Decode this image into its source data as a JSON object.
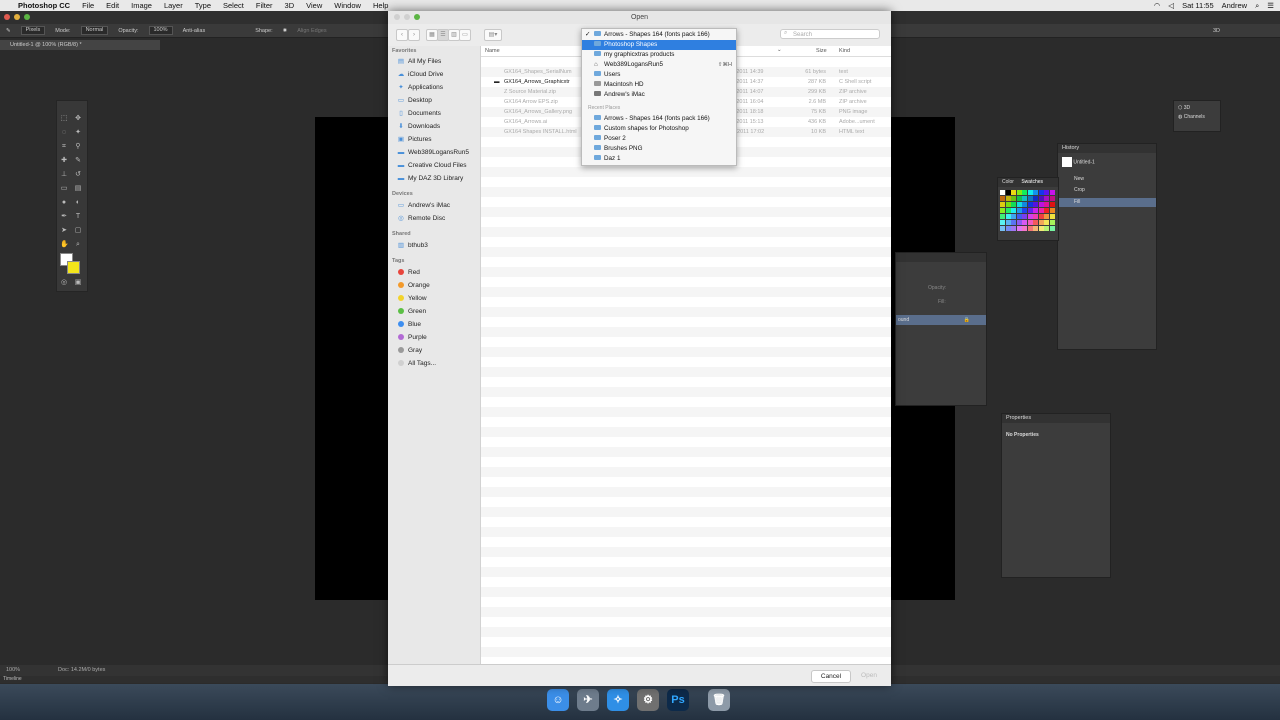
{
  "menubar": {
    "app_name": "Photoshop CC",
    "items": [
      "File",
      "Edit",
      "Image",
      "Layer",
      "Type",
      "Select",
      "Filter",
      "3D",
      "View",
      "Window",
      "Help"
    ],
    "clock": "Sat 11:55",
    "user": "Andrew"
  },
  "options_bar": {
    "tool_mode": "Pixels",
    "mode_label": "Mode:",
    "mode_value": "Normal",
    "opacity_label": "Opacity:",
    "opacity_value": "100%",
    "antialias_label": "Anti-alias",
    "shape_label": "Shape:",
    "align_edges_label": "Align Edges",
    "workspace_label": "3D"
  },
  "document": {
    "tab_title": "Untitled-1 @ 100% (RGB/8) *",
    "zoom": "100%",
    "doc_info": "Doc: 14.2M/0 bytes",
    "timeline_label": "Timeline"
  },
  "panels": {
    "mini": {
      "item1": "3D",
      "item2": "Channels"
    },
    "history": {
      "title": "History",
      "snapshot": "Untitled-1",
      "states": [
        "New",
        "Crop",
        "Fill"
      ]
    },
    "color": {
      "tab1": "Color",
      "tab2": "Swatches"
    },
    "layers": {
      "opacity_label": "Opacity:",
      "fill_label": "Fill:",
      "layer_name": "ound"
    },
    "properties": {
      "title": "Properties",
      "content": "No Properties"
    }
  },
  "dialog": {
    "title": "Open",
    "search_placeholder": "Search",
    "sidebar": {
      "favorites_header": "Favorites",
      "favorites": [
        {
          "label": "All My Files",
          "icon": "all-files-icon"
        },
        {
          "label": "iCloud Drive",
          "icon": "cloud-icon"
        },
        {
          "label": "Applications",
          "icon": "applications-icon"
        },
        {
          "label": "Desktop",
          "icon": "desktop-icon"
        },
        {
          "label": "Documents",
          "icon": "documents-icon"
        },
        {
          "label": "Downloads",
          "icon": "downloads-icon"
        },
        {
          "label": "Pictures",
          "icon": "pictures-icon"
        },
        {
          "label": "Web389LogansRun5",
          "icon": "folder-icon"
        },
        {
          "label": "Creative Cloud Files",
          "icon": "folder-icon"
        },
        {
          "label": "My DAZ 3D Library",
          "icon": "folder-icon"
        }
      ],
      "devices_header": "Devices",
      "devices": [
        {
          "label": "Andrew's iMac",
          "icon": "imac-icon"
        },
        {
          "label": "Remote Disc",
          "icon": "disc-icon"
        }
      ],
      "shared_header": "Shared",
      "shared": [
        {
          "label": "bthub3",
          "icon": "server-icon"
        }
      ],
      "tags_header": "Tags",
      "tags": [
        {
          "label": "Red",
          "color": "#e8453c"
        },
        {
          "label": "Orange",
          "color": "#f39a2b"
        },
        {
          "label": "Yellow",
          "color": "#f2d32c"
        },
        {
          "label": "Green",
          "color": "#5bbf45"
        },
        {
          "label": "Blue",
          "color": "#3d8ef0"
        },
        {
          "label": "Purple",
          "color": "#b26ad4"
        },
        {
          "label": "Gray",
          "color": "#9a9a9a"
        },
        {
          "label": "All Tags...",
          "color": "#d0d0d0"
        }
      ]
    },
    "columns": {
      "name": "Name",
      "date": "d",
      "size": "Size",
      "kind": "Kind"
    },
    "files": [
      {
        "name": "GX164_Shapes_SerialNum",
        "date": "r 2011 14:39",
        "size": "61 bytes",
        "kind": "text",
        "enabled": false
      },
      {
        "name": "GX164_Arrows_Graphicxtr",
        "date": "r 2011 14:37",
        "size": "287 KB",
        "kind": "C Shell script",
        "enabled": true
      },
      {
        "name": "Z Source Material.zip",
        "date": "r 2011 14:07",
        "size": "299 KB",
        "kind": "ZIP archive",
        "enabled": false
      },
      {
        "name": "GX164 Arrow EPS.zip",
        "date": "r 2011 16:04",
        "size": "2.6 MB",
        "kind": "ZIP archive",
        "enabled": false
      },
      {
        "name": "GX164_Arrows_Gallery.png",
        "date": "r 2011 18:18",
        "size": "75 KB",
        "kind": "PNG image",
        "enabled": false
      },
      {
        "name": "GX164_Arrows.ai",
        "date": "r 2011 15:13",
        "size": "436 KB",
        "kind": "Adobe...ument",
        "enabled": false
      },
      {
        "name": "GX164 Shapes INSTALL.html",
        "date": "mber 2011 17:02",
        "size": "10 KB",
        "kind": "HTML text",
        "enabled": false
      }
    ],
    "path_menu": {
      "current": "Arrows - Shapes 164 (fonts pack 166)",
      "parents": [
        {
          "label": "Photoshop Shapes",
          "selected": true,
          "shortcut": ""
        },
        {
          "label": "my graphicxtras products",
          "selected": false,
          "shortcut": ""
        },
        {
          "label": "Web389LogansRun5",
          "selected": false,
          "shortcut": "⇧⌘H"
        },
        {
          "label": "Users",
          "selected": false,
          "shortcut": ""
        },
        {
          "label": "Macintosh HD",
          "selected": false,
          "shortcut": ""
        },
        {
          "label": "Andrew's iMac",
          "selected": false,
          "shortcut": ""
        }
      ],
      "recent_header": "Recent Places",
      "recent": [
        "Arrows - Shapes 164 (fonts pack 166)",
        "Custom shapes for Photoshop",
        "Poser 2",
        "Brushes PNG",
        "Daz 1"
      ]
    },
    "cancel_label": "Cancel",
    "open_label": "Open"
  },
  "dock": [
    {
      "name": "finder-icon",
      "glyph": "☺",
      "color": "#3b8ee8"
    },
    {
      "name": "launchpad-icon",
      "glyph": "✈",
      "color": "#6e7c8c"
    },
    {
      "name": "safari-icon",
      "glyph": "✧",
      "color": "#2f8fe6"
    },
    {
      "name": "system-preferences-icon",
      "glyph": "⚙",
      "color": "#707070"
    },
    {
      "name": "photoshop-icon",
      "glyph": "Ps",
      "color": "#0d2a4a"
    },
    {
      "name": "trash-icon",
      "glyph": "🗑",
      "color": "#8d9aa8"
    }
  ]
}
